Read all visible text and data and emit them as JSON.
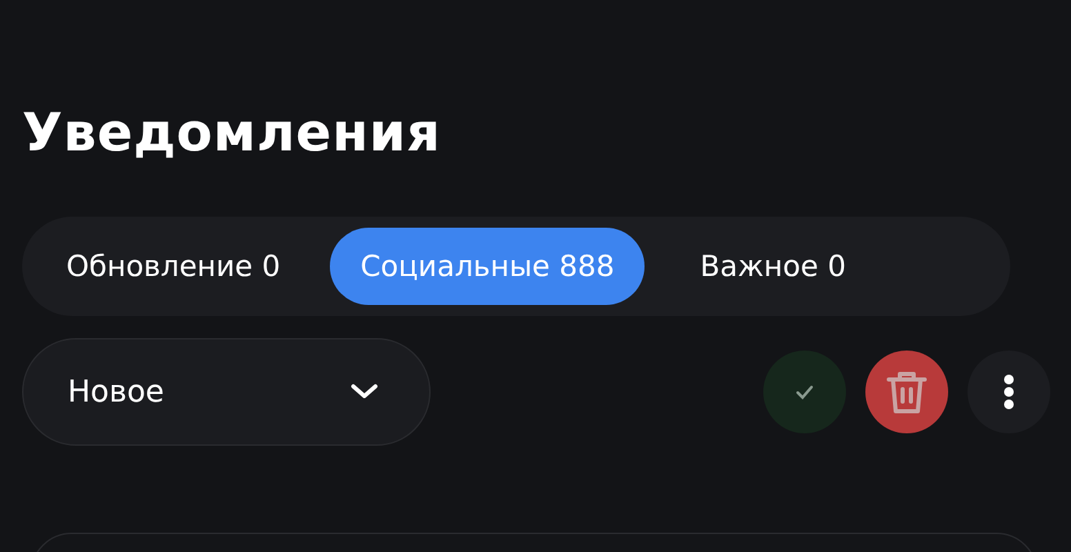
{
  "title": "Уведомления",
  "tabs": [
    {
      "label": "Обновление 0",
      "selected": false
    },
    {
      "label": "Социальные 888",
      "selected": true
    },
    {
      "label": "Важное 0",
      "selected": false
    }
  ],
  "filter": {
    "value": "Новое"
  }
}
